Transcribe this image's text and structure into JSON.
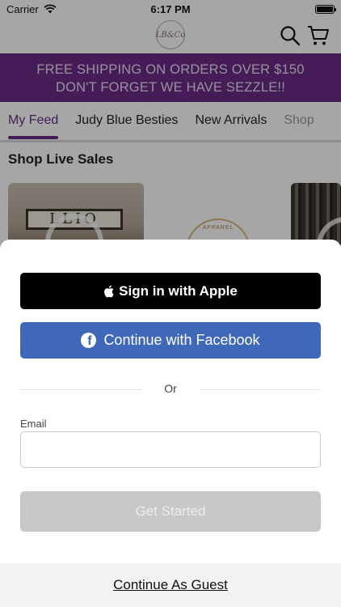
{
  "status_bar": {
    "carrier": "Carrier",
    "time": "6:17 PM"
  },
  "header": {
    "logo_text": "LB&Co",
    "search_icon": "search-icon",
    "cart_icon": "cart-icon"
  },
  "banner": {
    "line1": "FREE SHIPPING ON ORDERS OVER $150",
    "line2": "DON'T FORGET WE HAVE SEZZLE!!"
  },
  "tabs": [
    {
      "label": "My Feed"
    },
    {
      "label": "Judy Blue Besties"
    },
    {
      "label": "New Arrivals"
    },
    {
      "label": "Shop"
    }
  ],
  "section": {
    "title": "Shop Live Sales",
    "badge_text": "APPAREL"
  },
  "sheet": {
    "apple_label": "Sign in with Apple",
    "facebook_label": "Continue with Facebook",
    "or_label": "Or",
    "email_label": "Email",
    "email_value": "",
    "get_started_label": "Get Started",
    "guest_label": "Continue As Guest"
  },
  "colors": {
    "brand_purple": "#6a2b86",
    "facebook_blue": "#3f68b8",
    "disabled_gray": "#c8c8c8"
  }
}
